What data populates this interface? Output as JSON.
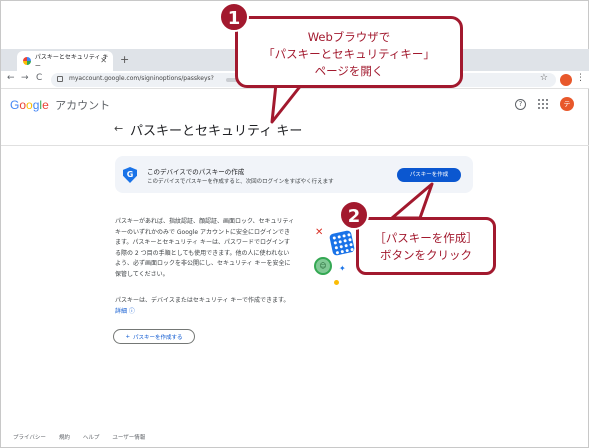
{
  "browser": {
    "tab_title": "パスキーとセキュリティ キー",
    "tab_close": "✕",
    "new_tab": "+",
    "url": "myaccount.google.com/signinoptions/passkeys?",
    "back": "←",
    "forward": "→",
    "reload": "C",
    "star": "☆",
    "menu": "⋮"
  },
  "header": {
    "logo_letters": [
      "G",
      "o",
      "o",
      "g",
      "l",
      "e"
    ],
    "account_label": "アカウント",
    "help": "?",
    "avatar_initial": "テ"
  },
  "page": {
    "back_arrow": "←",
    "title": "パスキーとセキュリティ キー"
  },
  "banner": {
    "icon": "G",
    "title": "このデバイスでのパスキーの作成",
    "subtitle": "このデバイスでパスキーを作成すると、次回のログインをすばやく行えます",
    "button": "パスキーを作成"
  },
  "body": {
    "paragraph1": "パスキーがあれば、指紋認証、顔認証、画面ロック、セキュリティ キーのいずれかのみで Google アカウントに安全にログインできます。パスキーとセキュリティ キーは、パスワードでログインする際の 2 つ目の手順としても使用できます。他の人に使われないよう、必ず画面ロックを非公開にし、セキュリティ キーを安全に保管してください。",
    "paragraph2": "パスキーは、デバイスまたはセキュリティ キーで作成できます。",
    "learn_more": "詳細",
    "create_button": "パスキーを作成する",
    "create_button_icon": "+"
  },
  "footer": {
    "links": [
      "プライバシー",
      "規約",
      "ヘルプ",
      "ユーザー情報"
    ]
  },
  "callouts": {
    "one": {
      "number": "1",
      "lines": [
        "Webブラウザで",
        "「パスキーとセキュリティキー」",
        "ページを開く"
      ]
    },
    "two": {
      "number": "2",
      "lines": [
        "［パスキーを作成］",
        "ボタンをクリック"
      ]
    }
  },
  "colors": {
    "accent": "#0b57d0",
    "callout": "#a2192e"
  }
}
